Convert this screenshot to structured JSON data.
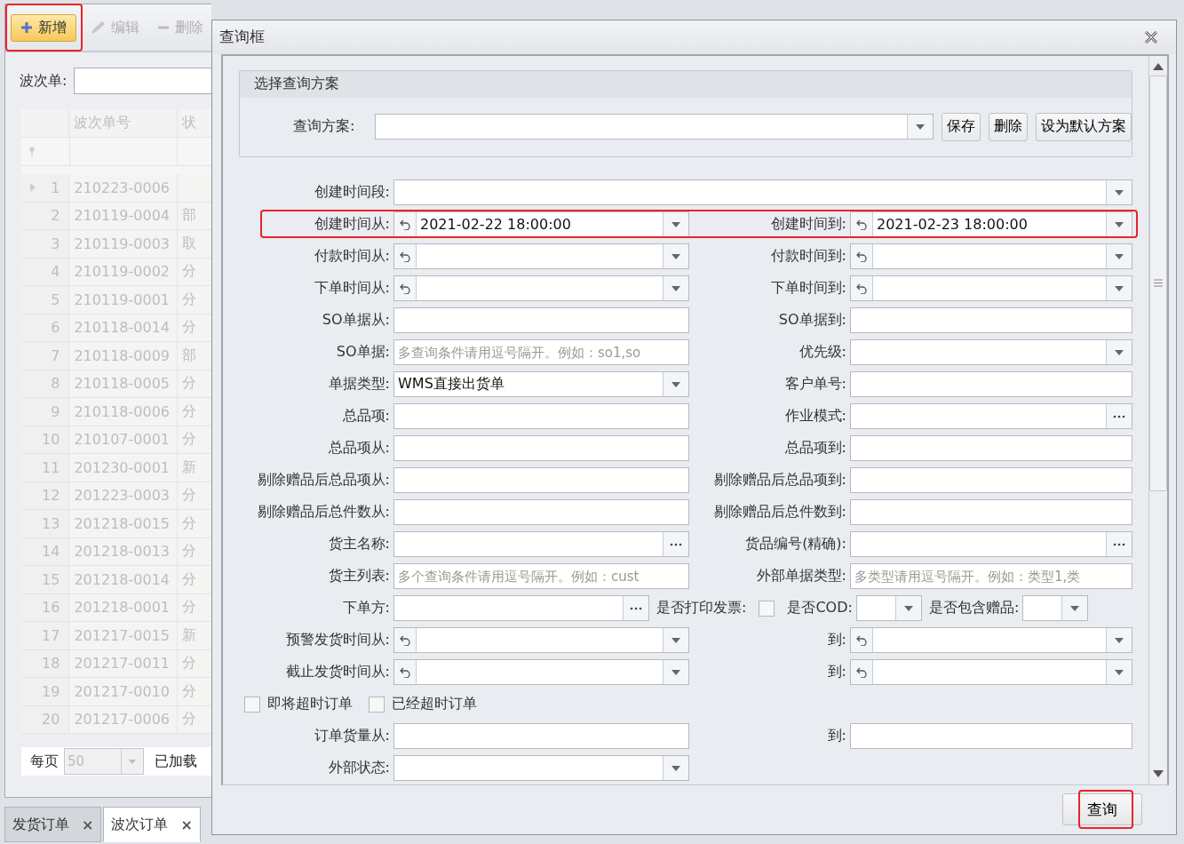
{
  "app": {
    "toolbar": [
      {
        "label": "新增",
        "active": true,
        "highlighted": true
      },
      {
        "label": "编辑",
        "active": false,
        "highlighted": false
      },
      {
        "label": "删除",
        "active": false,
        "highlighted": false
      }
    ],
    "filter": {
      "label": "波次单:"
    },
    "grid": {
      "columns": [
        "波次单号",
        "状"
      ],
      "rows": [
        {
          "no": "1",
          "code": "210223-0006",
          "current": true
        },
        {
          "no": "2",
          "code": "210119-0004",
          "status": "部",
          "current": false
        },
        {
          "no": "3",
          "code": "210119-0003",
          "status": "取",
          "current": false
        },
        {
          "no": "4",
          "code": "210119-0002",
          "status": "分",
          "current": false
        },
        {
          "no": "5",
          "code": "210119-0001",
          "status": "分",
          "current": false
        },
        {
          "no": "6",
          "code": "210118-0014",
          "status": "分",
          "current": false
        },
        {
          "no": "7",
          "code": "210118-0009",
          "status": "部",
          "current": false
        },
        {
          "no": "8",
          "code": "210118-0005",
          "status": "分",
          "current": false
        },
        {
          "no": "9",
          "code": "210118-0006",
          "status": "分",
          "current": false
        },
        {
          "no": "10",
          "code": "210107-0001",
          "status": "分",
          "current": false
        },
        {
          "no": "11",
          "code": "201230-0001",
          "status": "新",
          "current": false
        },
        {
          "no": "12",
          "code": "201223-0003",
          "status": "分",
          "current": false
        },
        {
          "no": "13",
          "code": "201218-0015",
          "status": "分",
          "current": false
        },
        {
          "no": "14",
          "code": "201218-0013",
          "status": "分",
          "current": false
        },
        {
          "no": "15",
          "code": "201218-0014",
          "status": "分",
          "current": false
        },
        {
          "no": "16",
          "code": "201218-0001",
          "status": "分",
          "current": false
        },
        {
          "no": "17",
          "code": "201217-0015",
          "status": "新",
          "current": false
        },
        {
          "no": "18",
          "code": "201217-0011",
          "status": "分",
          "current": false
        },
        {
          "no": "19",
          "code": "201217-0010",
          "status": "分",
          "current": false
        },
        {
          "no": "20",
          "code": "201217-0006",
          "status": "分",
          "current": false
        }
      ]
    },
    "pager": {
      "label": "每页",
      "page_size": "50",
      "loaded": "已加载"
    },
    "tabs": [
      {
        "label": "发货订单",
        "close": "×",
        "selected": false
      },
      {
        "label": "波次订单",
        "close": "×",
        "selected": true
      }
    ]
  },
  "dialog": {
    "title": "查询框",
    "scheme_group": {
      "title": "选择查询方案",
      "label": "查询方案:",
      "buttons": [
        "保存",
        "删除",
        "设为默认方案"
      ]
    },
    "rows": [
      {
        "kind": "full",
        "highlighted": false,
        "fields": [
          {
            "label": "创建时间段:",
            "kind": "combo"
          }
        ]
      },
      {
        "kind": "pair",
        "highlighted": true,
        "fields": [
          {
            "label": "创建时间从:",
            "kind": "datetime",
            "value": "2021-02-22 18:00:00"
          },
          {
            "label": "创建时间到:",
            "kind": "datetime",
            "value": "2021-02-23 18:00:00"
          }
        ]
      },
      {
        "kind": "pair",
        "highlighted": false,
        "fields": [
          {
            "label": "付款时间从:",
            "kind": "datetime"
          },
          {
            "label": "付款时间到:",
            "kind": "datetime"
          }
        ]
      },
      {
        "kind": "pair",
        "highlighted": false,
        "fields": [
          {
            "label": "下单时间从:",
            "kind": "datetime"
          },
          {
            "label": "下单时间到:",
            "kind": "datetime"
          }
        ]
      },
      {
        "kind": "pair",
        "highlighted": false,
        "fields": [
          {
            "label": "SO单据从:",
            "kind": "text"
          },
          {
            "label": "SO单据到:",
            "kind": "text"
          }
        ]
      },
      {
        "kind": "pair",
        "highlighted": false,
        "fields": [
          {
            "label": "SO单据:",
            "kind": "text",
            "placeholder": "多查询条件请用逗号隔开。例如：so1,so"
          },
          {
            "label": "优先级:",
            "kind": "combo"
          }
        ]
      },
      {
        "kind": "pair",
        "highlighted": false,
        "fields": [
          {
            "label": "单据类型:",
            "kind": "combo",
            "value": "WMS直接出货单"
          },
          {
            "label": "客户单号:",
            "kind": "text"
          }
        ]
      },
      {
        "kind": "pair",
        "highlighted": false,
        "fields": [
          {
            "label": "总品项:",
            "kind": "text"
          },
          {
            "label": "作业模式:",
            "kind": "lookup"
          }
        ]
      },
      {
        "kind": "pair",
        "highlighted": false,
        "fields": [
          {
            "label": "总品项从:",
            "kind": "text"
          },
          {
            "label": "总品项到:",
            "kind": "text"
          }
        ]
      },
      {
        "kind": "pair",
        "highlighted": false,
        "fields": [
          {
            "label": "剔除赠品后总品项从:",
            "kind": "text"
          },
          {
            "label": "剔除赠品后总品项到:",
            "kind": "text"
          }
        ]
      },
      {
        "kind": "pair",
        "highlighted": false,
        "fields": [
          {
            "label": "剔除赠品后总件数从:",
            "kind": "text"
          },
          {
            "label": "剔除赠品后总件数到:",
            "kind": "text"
          }
        ]
      },
      {
        "kind": "pair",
        "highlighted": false,
        "fields": [
          {
            "label": "货主名称:",
            "kind": "lookup"
          },
          {
            "label": "货品编号(精确):",
            "kind": "lookup"
          }
        ]
      },
      {
        "kind": "pair",
        "highlighted": false,
        "fields": [
          {
            "label": "货主列表:",
            "kind": "text",
            "placeholder": "多个查询条件请用逗号隔开。例如：cust"
          },
          {
            "label": "外部单据类型:",
            "kind": "text",
            "placeholder": "多类型请用逗号隔开。例如：类型1,类"
          }
        ]
      },
      {
        "kind": "mixed",
        "highlighted": false,
        "fields": [
          {
            "label": "下单方:",
            "kind": "lookup"
          },
          {
            "label": "是否打印发票:",
            "kind": "checkbox",
            "checked": false
          },
          {
            "label": "是否COD:",
            "kind": "combo"
          },
          {
            "label": "是否包含赠品:",
            "kind": "combo"
          }
        ]
      },
      {
        "kind": "pair",
        "highlighted": false,
        "fields": [
          {
            "label": "预警发货时间从:",
            "kind": "datetime"
          },
          {
            "label": "到:",
            "kind": "datetime"
          }
        ]
      },
      {
        "kind": "pair",
        "highlighted": false,
        "fields": [
          {
            "label": "截止发货时间从:",
            "kind": "datetime"
          },
          {
            "label": "到:",
            "kind": "datetime"
          }
        ]
      },
      {
        "kind": "checks",
        "highlighted": false,
        "fields": [
          {
            "label": "即将超时订单",
            "kind": "checkbox",
            "checked": false
          },
          {
            "label": "已经超时订单",
            "kind": "checkbox",
            "checked": false
          }
        ]
      },
      {
        "kind": "pair",
        "highlighted": false,
        "fields": [
          {
            "label": "订单货量从:",
            "kind": "text"
          },
          {
            "label": "到:",
            "kind": "text"
          }
        ]
      },
      {
        "kind": "left",
        "highlighted": false,
        "fields": [
          {
            "label": "外部状态:",
            "kind": "combo"
          }
        ]
      }
    ],
    "query_button": {
      "label": "查询",
      "highlighted": true
    }
  }
}
